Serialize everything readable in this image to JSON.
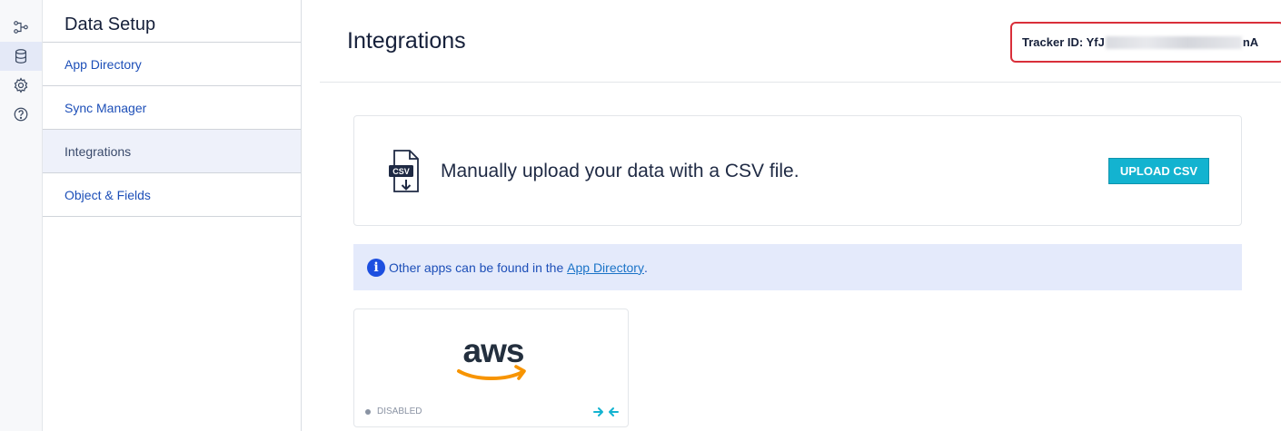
{
  "rail": {
    "icons": [
      "workflow-icon",
      "database-icon",
      "settings-icon",
      "help-icon"
    ],
    "active": "database-icon"
  },
  "sidebar": {
    "title": "Data Setup",
    "items": [
      {
        "label": "App Directory"
      },
      {
        "label": "Sync Manager"
      },
      {
        "label": "Integrations"
      },
      {
        "label": "Object & Fields"
      }
    ]
  },
  "header": {
    "title": "Integrations",
    "tracker": {
      "prefix": "Tracker ID: YfJ",
      "suffix": "nA"
    }
  },
  "csv_card": {
    "icon_text": "CSV",
    "text": "Manually upload your data with a CSV file.",
    "button": "UPLOAD CSV"
  },
  "info": {
    "icon": "i",
    "text_before": "Other apps can be found in the ",
    "link": "App Directory",
    "text_after": "."
  },
  "apps": [
    {
      "name": "aws",
      "status": "DISABLED"
    }
  ],
  "colors": {
    "accent": "#13b3d0",
    "link": "#1d4fb8",
    "highlight_border": "#d92f3a",
    "aws_orange": "#f79400"
  }
}
